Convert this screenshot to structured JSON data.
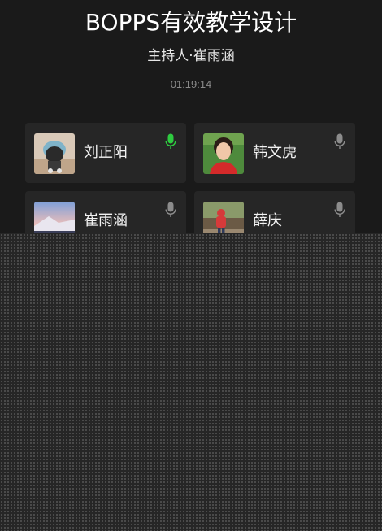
{
  "meeting": {
    "title": "BOPPS有效教学设计",
    "host_line": "主持人·崔雨涵",
    "elapsed": "01:19:14"
  },
  "participants": [
    {
      "name": "刘正阳",
      "mic": "active",
      "avatar_icon": "child-with-blue-hat-avatar"
    },
    {
      "name": "韩文虎",
      "mic": "idle",
      "avatar_icon": "girl-red-shirt-avatar"
    },
    {
      "name": "崔雨涵",
      "mic": "idle",
      "avatar_icon": "sunset-landscape-avatar"
    },
    {
      "name": "薛庆",
      "mic": "idle",
      "avatar_icon": "person-outdoors-avatar"
    }
  ],
  "colors": {
    "background": "#1a1a1a",
    "card": "#262626",
    "mic_active": "#2ecc40",
    "mic_idle": "#8c8c8c"
  }
}
